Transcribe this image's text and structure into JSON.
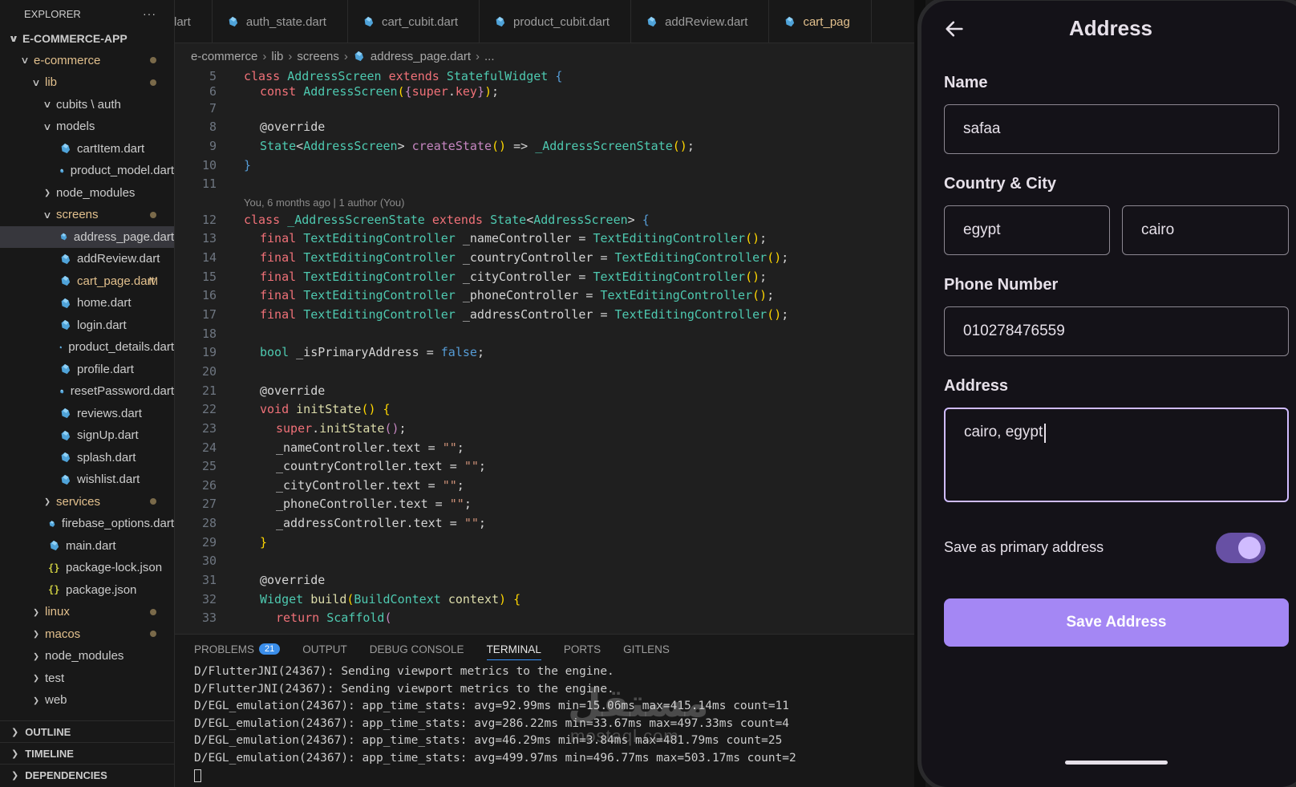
{
  "sidebar": {
    "title": "EXPLORER",
    "more": "···",
    "items": [
      {
        "label": "E-COMMERCE-APP",
        "indent": 0,
        "chevron": "open",
        "bold": true
      },
      {
        "label": "e-commerce",
        "indent": 1,
        "chevron": "open",
        "color": "orange",
        "dot": true
      },
      {
        "label": "lib",
        "indent": 2,
        "chevron": "open",
        "color": "orange",
        "dot": true
      },
      {
        "label": "cubits \\ auth",
        "indent": 3,
        "chevron": "open"
      },
      {
        "label": "models",
        "indent": 3,
        "chevron": "open"
      },
      {
        "label": "cartItem.dart",
        "indent": 4,
        "icon": "dart"
      },
      {
        "label": "product_model.dart",
        "indent": 4,
        "icon": "dart"
      },
      {
        "label": "node_modules",
        "indent": 3,
        "chevron": "closed"
      },
      {
        "label": "screens",
        "indent": 3,
        "chevron": "open",
        "color": "orange",
        "dot": true
      },
      {
        "label": "address_page.dart",
        "indent": 4,
        "icon": "dart",
        "selected": true
      },
      {
        "label": "addReview.dart",
        "indent": 4,
        "icon": "dart"
      },
      {
        "label": "cart_page.dart",
        "indent": 4,
        "icon": "dart",
        "color": "orange",
        "mark": "M"
      },
      {
        "label": "home.dart",
        "indent": 4,
        "icon": "dart"
      },
      {
        "label": "login.dart",
        "indent": 4,
        "icon": "dart"
      },
      {
        "label": "product_details.dart",
        "indent": 4,
        "icon": "dart"
      },
      {
        "label": "profile.dart",
        "indent": 4,
        "icon": "dart"
      },
      {
        "label": "resetPassword.dart",
        "indent": 4,
        "icon": "dart"
      },
      {
        "label": "reviews.dart",
        "indent": 4,
        "icon": "dart"
      },
      {
        "label": "signUp.dart",
        "indent": 4,
        "icon": "dart"
      },
      {
        "label": "splash.dart",
        "indent": 4,
        "icon": "dart"
      },
      {
        "label": "wishlist.dart",
        "indent": 4,
        "icon": "dart"
      },
      {
        "label": "services",
        "indent": 3,
        "chevron": "closed",
        "color": "orange",
        "dot": true
      },
      {
        "label": "firebase_options.dart",
        "indent": 3,
        "icon": "dart"
      },
      {
        "label": "main.dart",
        "indent": 3,
        "icon": "dart"
      },
      {
        "label": "package-lock.json",
        "indent": 3,
        "icon": "json"
      },
      {
        "label": "package.json",
        "indent": 3,
        "icon": "json"
      },
      {
        "label": "linux",
        "indent": 2,
        "chevron": "closed",
        "color": "orange",
        "dot": true
      },
      {
        "label": "macos",
        "indent": 2,
        "chevron": "closed",
        "color": "orange",
        "dot": true
      },
      {
        "label": "node_modules",
        "indent": 2,
        "chevron": "closed"
      },
      {
        "label": "test",
        "indent": 2,
        "chevron": "closed"
      },
      {
        "label": "web",
        "indent": 2,
        "chevron": "closed"
      }
    ],
    "sections": [
      "OUTLINE",
      "TIMELINE",
      "DEPENDENCIES"
    ]
  },
  "editor": {
    "tabs": [
      {
        "label": "dart",
        "icon": false
      },
      {
        "label": "auth_state.dart",
        "icon": true
      },
      {
        "label": "cart_cubit.dart",
        "icon": true
      },
      {
        "label": "product_cubit.dart",
        "icon": true
      },
      {
        "label": "addReview.dart",
        "icon": true
      },
      {
        "label": "cart_pag",
        "icon": true,
        "color": "orange"
      }
    ],
    "breadcrumb": [
      "e-commerce",
      "lib",
      "screens",
      "address_page.dart",
      "..."
    ],
    "blame": "You, 6 months ago | 1 author (You)"
  },
  "panel": {
    "tabs": [
      "PROBLEMS",
      "OUTPUT",
      "DEBUG CONSOLE",
      "TERMINAL",
      "PORTS",
      "GITLENS"
    ],
    "problems_count": "21",
    "active_tab": "TERMINAL",
    "terminal_lines": [
      "D/FlutterJNI(24367): Sending viewport metrics to the engine.",
      "D/FlutterJNI(24367): Sending viewport metrics to the engine.",
      "D/EGL_emulation(24367): app_time_stats: avg=92.99ms min=15.06ms max=415.14ms count=11",
      "D/EGL_emulation(24367): app_time_stats: avg=286.22ms min=33.67ms max=497.33ms count=4",
      "D/EGL_emulation(24367): app_time_stats: avg=46.29ms min=3.84ms max=481.79ms count=25",
      "D/EGL_emulation(24367): app_time_stats: avg=499.97ms min=496.77ms max=503.17ms count=2"
    ],
    "watermark": "مستقل",
    "watermark_sub": "mostaql.com"
  },
  "phone": {
    "title": "Address",
    "name_label": "Name",
    "name_value": "safaa",
    "country_city_label": "Country & City",
    "country_value": "egypt",
    "city_value": "cairo",
    "phone_label": "Phone Number",
    "phone_value": "010278476559",
    "address_label": "Address",
    "address_value": "cairo, egypt",
    "primary_label": "Save as primary address",
    "primary_on": true,
    "save_button": "Save Address",
    "colors": {
      "primary": "#a487f4",
      "toggle_track": "#6750a4",
      "toggle_knob": "#d0bcff",
      "background": "#141218"
    }
  }
}
